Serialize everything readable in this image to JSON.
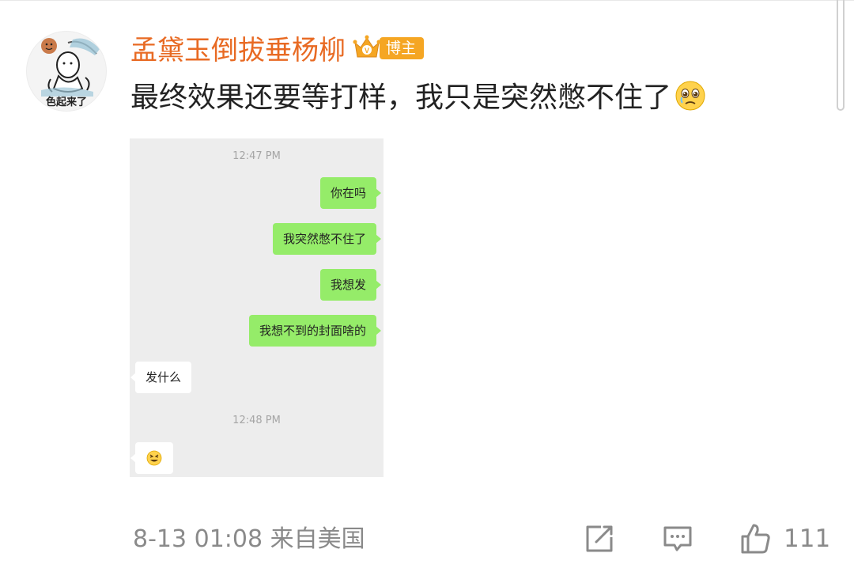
{
  "comment": {
    "author": "孟黛玉倒拔垂杨柳",
    "badge_label": "博主",
    "text": "最终效果还要等打样，我只是突然憋不住了",
    "emoji_icon": "crying-face-icon",
    "avatar_text": "色起来了"
  },
  "chat_screenshot": {
    "timestamps": [
      "12:47 PM",
      "12:48 PM"
    ],
    "messages": [
      {
        "from": "me",
        "text": "你在吗"
      },
      {
        "from": "me",
        "text": "我突然憋不住了"
      },
      {
        "from": "me",
        "text": "我想发"
      },
      {
        "from": "me",
        "text": "我想不到的封面啥的"
      },
      {
        "from": "them",
        "text": "发什么"
      },
      {
        "from": "them",
        "text": "",
        "icon": "grinning-squint-emoji-icon"
      }
    ]
  },
  "footer": {
    "meta": "8-13 01:08  来自美国",
    "share_icon": "share-icon",
    "reply_icon": "comment-icon",
    "like_icon": "thumbs-up-icon",
    "like_count": "111"
  },
  "colors": {
    "username": "#e86a23",
    "badge": "#f5a623",
    "my_bubble": "#95ec69",
    "chat_bg": "#ededed"
  }
}
